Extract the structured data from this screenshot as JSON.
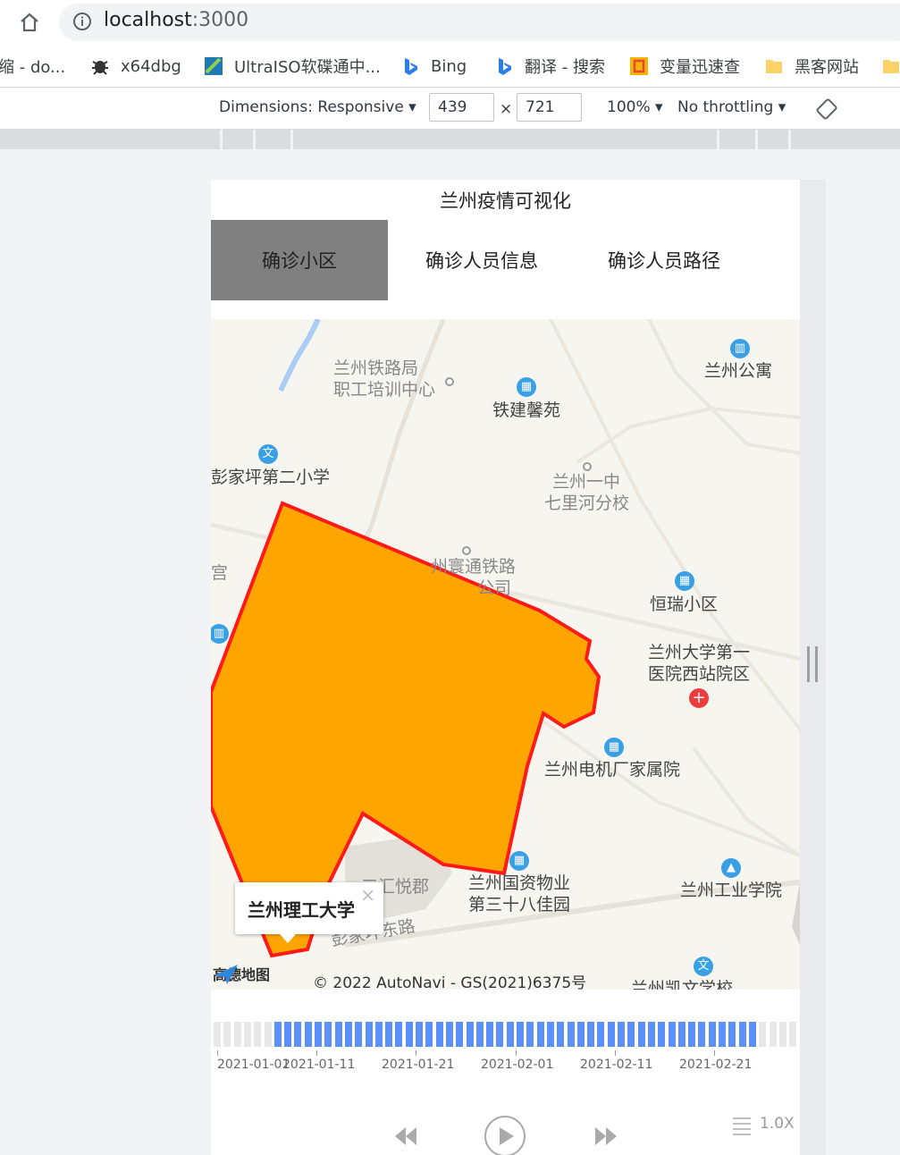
{
  "browser": {
    "url_host": "localhost",
    "url_port": ":3000",
    "bookmarks": [
      {
        "label": "缩 - do...",
        "icon": "page-icon"
      },
      {
        "label": "x64dbg",
        "icon": "bug-icon"
      },
      {
        "label": "UltraISO软碟通中...",
        "icon": "ultraiso-icon"
      },
      {
        "label": "Bing",
        "icon": "bing-icon"
      },
      {
        "label": "翻译 - 搜索",
        "icon": "bing-icon"
      },
      {
        "label": "变量迅速查",
        "icon": "app-icon"
      },
      {
        "label": "黑客网站",
        "icon": "folder-icon"
      }
    ]
  },
  "devtools": {
    "dimensions_label": "Dimensions: Responsive",
    "width": "439",
    "height": "721",
    "times": "×",
    "zoom": "100%",
    "throttling": "No throttling"
  },
  "app": {
    "title": "兰州疫情可视化",
    "tabs": [
      "确诊小区",
      "确诊人员信息",
      "确诊人员路径"
    ],
    "active_tab": 0
  },
  "map": {
    "labels": {
      "lz_railway_bureau_line1": "兰州铁路局",
      "lz_railway_bureau_line2": "职工培训中心",
      "tiejian": "铁建馨苑",
      "lz_apartment": "兰州公寓",
      "pengjiaping_school": "彭家坪第二小学",
      "lz_no1_line1": "兰州一中",
      "lz_no1_line2": "七里河分校",
      "railway_co_line1": "州寰通铁路",
      "railway_co_line2": "公司",
      "hengrui": "恒瑞小区",
      "hospital_line1": "兰州大学第一",
      "hospital_line2": "医院西站院区",
      "motor_factory": "兰州电机厂家属院",
      "guozi_line1": "兰州国资物业",
      "guozi_line2": "第三十八佳园",
      "industrial_college": "兰州工业学院",
      "huiyue": "三汇悦郡",
      "road": "彭家坪东路",
      "kaiwen": "兰州凯文学校",
      "partial_gong": "宫"
    },
    "popup_text": "兰州理工大学",
    "popup_close": "×",
    "logo_text": "高德地图",
    "copyright": "© 2022 AutoNavi - GS(2021)6375号",
    "polygon_fill": "#ffa500",
    "polygon_stroke": "#ff1a1a"
  },
  "timeline": {
    "labels": [
      "2021-01-01",
      "2021-01-11",
      "2021-01-21",
      "2021-02-01",
      "2021-02-11",
      "2021-02-21"
    ],
    "speed": "1.0X",
    "active_color": "#5b8ff9",
    "inactive_color": "#e8e8e8"
  }
}
